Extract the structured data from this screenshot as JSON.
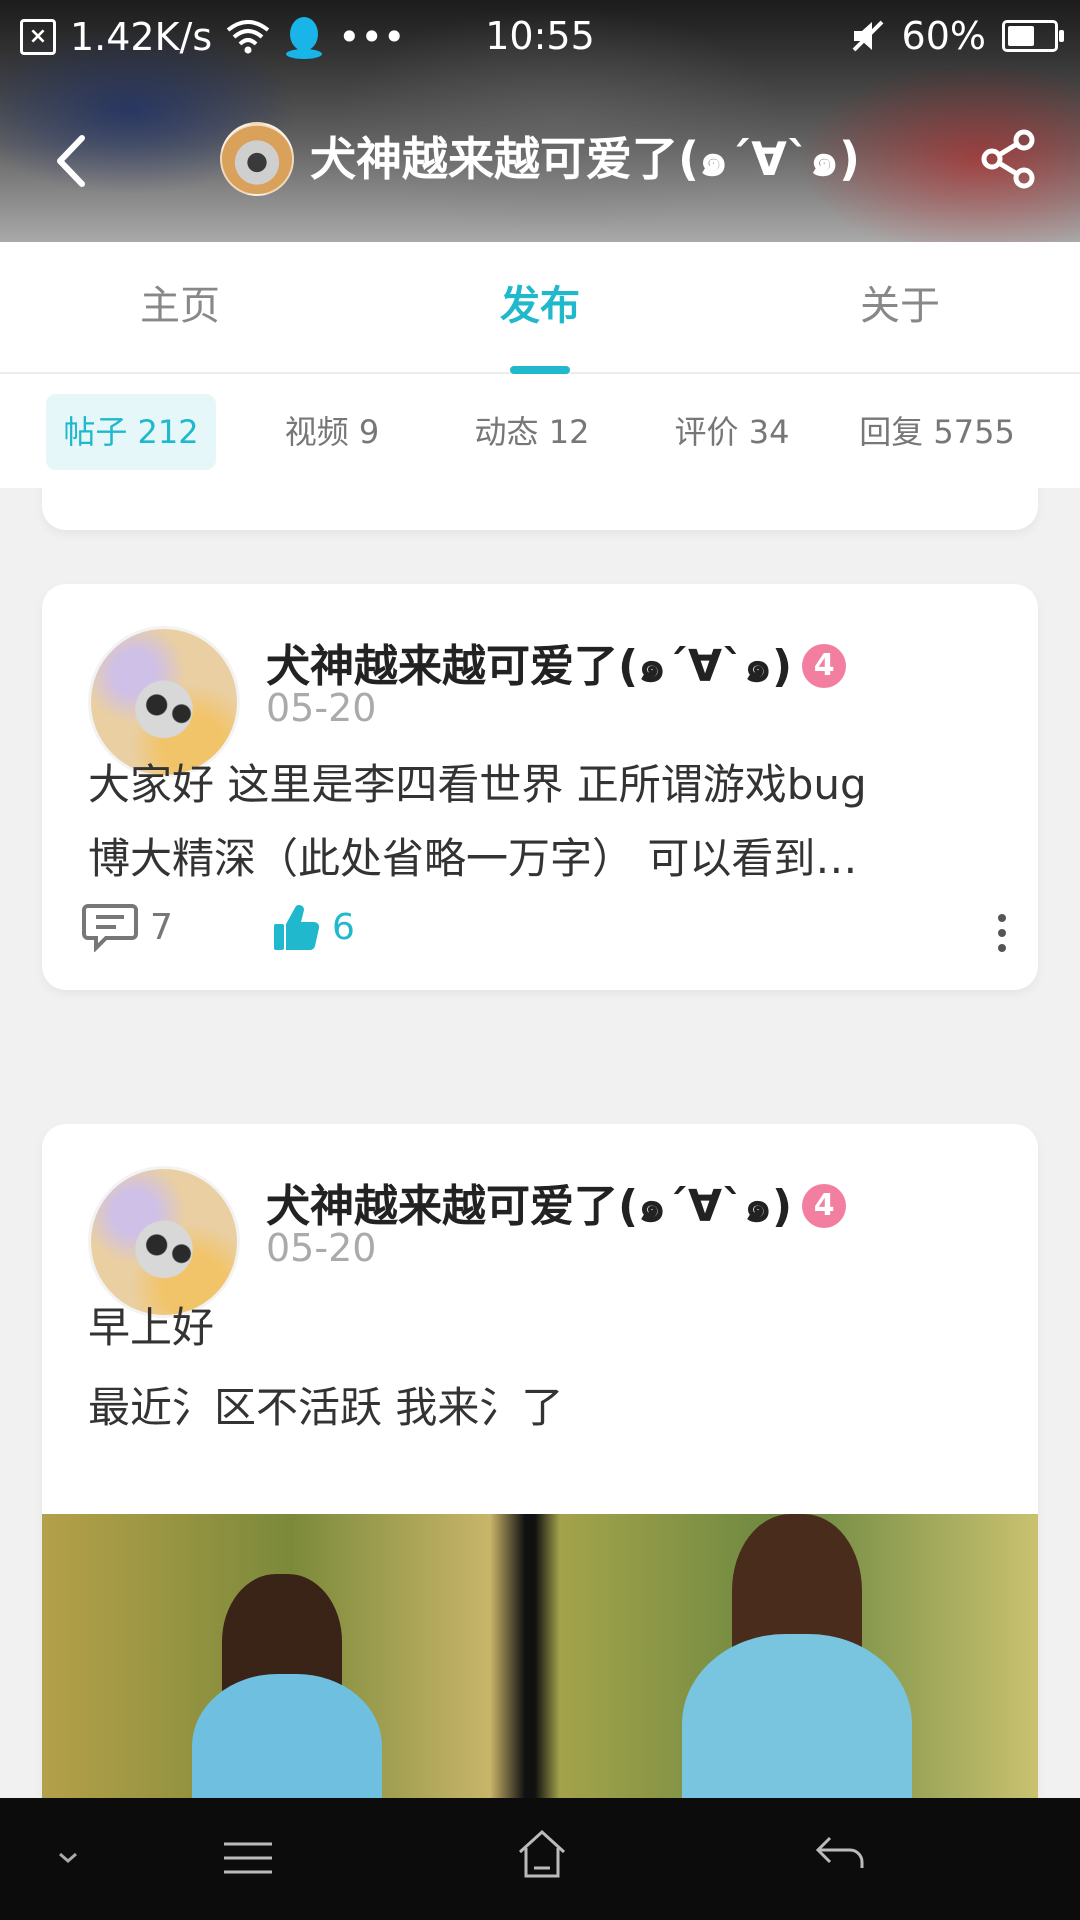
{
  "status_bar": {
    "speed": "1.42K/s",
    "time": "10:55",
    "battery": "60%",
    "battery_level": 0.6
  },
  "header": {
    "title": "犬神越来越可爱了(๑´∀`๑)"
  },
  "tabs": [
    {
      "label": "主页",
      "active": false
    },
    {
      "label": "发布",
      "active": true
    },
    {
      "label": "关于",
      "active": false
    }
  ],
  "filters": [
    {
      "label": "帖子 212",
      "active": true
    },
    {
      "label": "视频 9",
      "active": false
    },
    {
      "label": "动态 12",
      "active": false
    },
    {
      "label": "评价 34",
      "active": false
    },
    {
      "label": "回复 5755",
      "active": false
    }
  ],
  "posts": [
    {
      "author": "犬神越来越可爱了(๑´∀`๑)",
      "level": "4",
      "date": "05-20",
      "lines": [
        "大家好 这里是李四看世界 正所谓游戏bug",
        "博大精深（此处省略一万字） 可以看到…"
      ],
      "comments": "7",
      "likes": "6"
    },
    {
      "author": "犬神越来越可爱了(๑´∀`๑)",
      "level": "4",
      "date": "05-20",
      "lines": [
        "早上好",
        "最近氵区不活跃 我来氵了"
      ]
    }
  ]
}
